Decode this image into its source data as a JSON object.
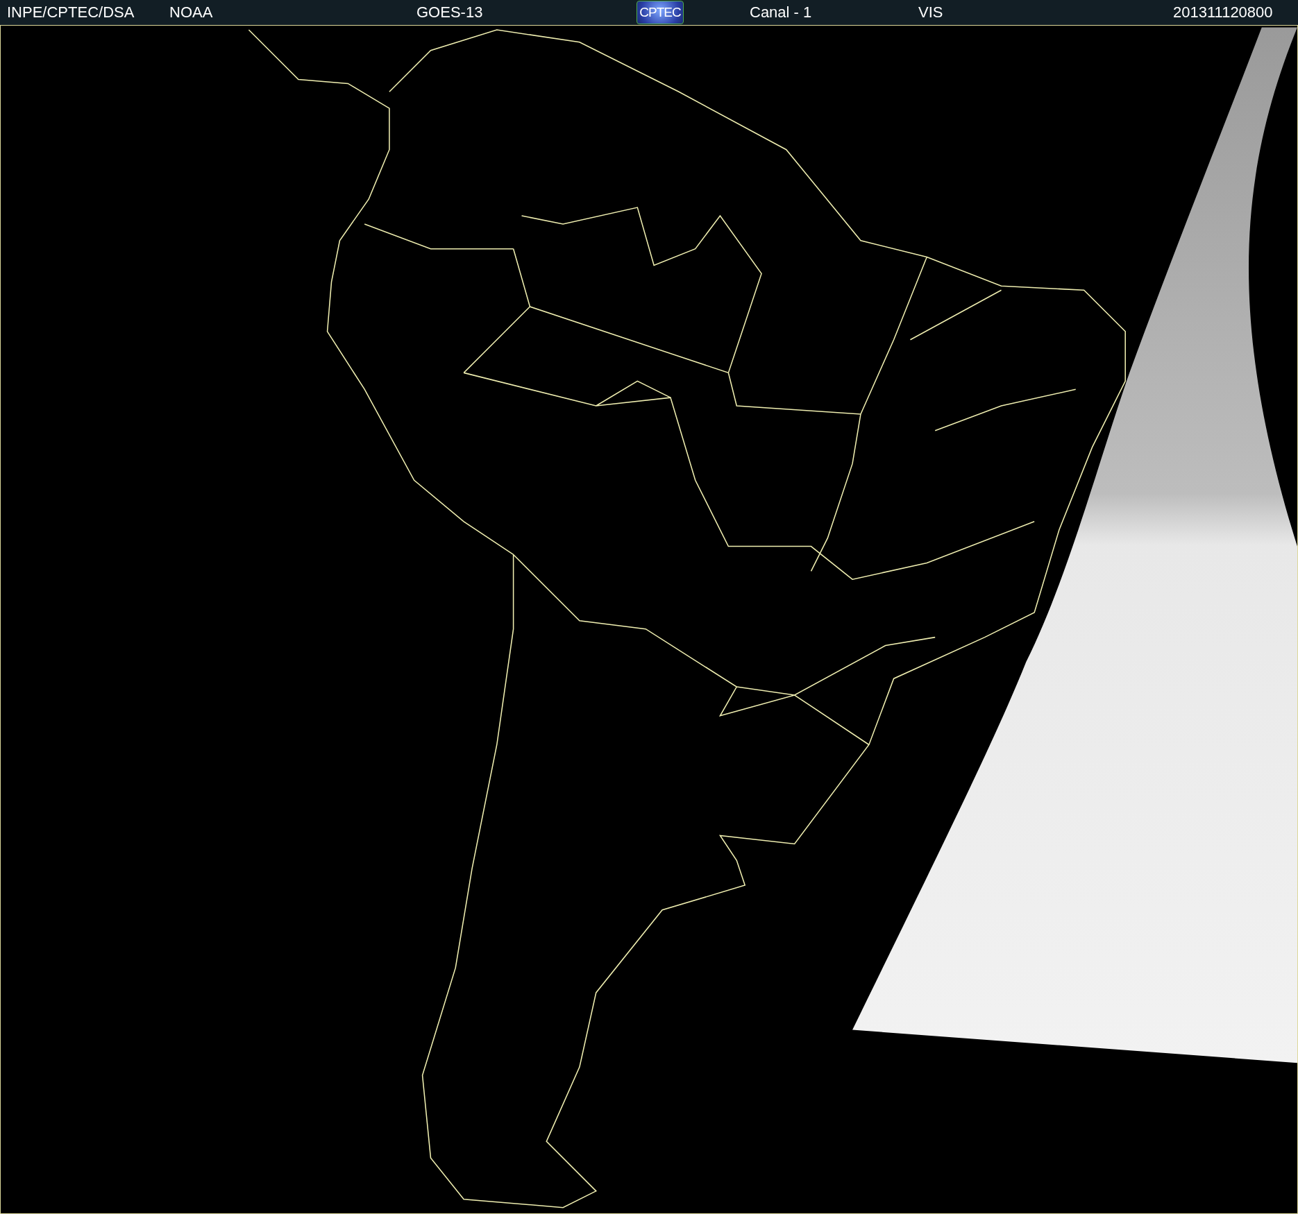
{
  "header": {
    "items": [
      {
        "kind": "text",
        "text": "INPE/CPTEC/DSA"
      },
      {
        "kind": "text",
        "text": "NOAA"
      },
      {
        "kind": "text",
        "text": "GOES-13"
      },
      {
        "kind": "logo",
        "text": "CPTEC"
      },
      {
        "kind": "text",
        "text": "Canal - 1"
      },
      {
        "kind": "text",
        "text": "VIS"
      },
      {
        "kind": "text",
        "text": "201311120800"
      }
    ]
  }
}
